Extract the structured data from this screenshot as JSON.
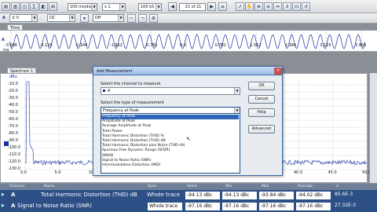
{
  "toolbar": {
    "channel": "A",
    "range": "± V",
    "coupling": "DC",
    "timebase": "100 ms/div",
    "multiplier": "x 1",
    "samples": "100 kS",
    "page": "21 of 21",
    "trigger": "Off"
  },
  "time_view": {
    "tab": "Time",
    "unit": "ms",
    "ticks": [
      "-3.906",
      "-3.125",
      "-2.344",
      "-1.562",
      "-0.781",
      "0.0",
      "0.781",
      "1.562",
      "2.344",
      "3.125",
      "3.906"
    ],
    "y_label": "A"
  },
  "spectrum": {
    "tab": "Spectrum 1",
    "unit": "dBu",
    "y_ticks": [
      "-10.0",
      "-20.0",
      "-30.0",
      "-40.0",
      "-50.0",
      "-60.0",
      "-70.0",
      "-80.0",
      "-90.0",
      "-100.0",
      "-110.0",
      "-120.0",
      "-130.0"
    ],
    "x_ticks": [
      "0.0",
      "5.0",
      "10.0",
      "15.0",
      "20.0",
      "25.0",
      "30.0",
      "35.0",
      "40.0",
      "45.0",
      "50.0"
    ]
  },
  "dialog": {
    "title": "Add Measurement",
    "channel_label": "Select the channel to measure",
    "channel_value": "A",
    "type_label": "Select the type of measurement",
    "type_value": "Frequency at Peak",
    "buttons": {
      "ok": "OK",
      "cancel": "Cancel",
      "help": "Help",
      "advanced": "Advanced"
    },
    "options": [
      "Frequency at Peak",
      "Amplitude at Peak",
      "Average Amplitude at Peak",
      "Total Power",
      "Total Harmonic Distortion (THD) %",
      "Total Harmonic Distortion (THD) dB",
      "Total Harmonic Distortion plus Noise (THD+N)",
      "Spurious Free Dynamic Range (SFDR)",
      "SINAD",
      "Signal to Noise Ratio (SNR)",
      "Intermodulation Distortion (IMD)"
    ],
    "selected_index": 0
  },
  "measurements": {
    "headers": [
      "Channel",
      "Name",
      "Span",
      "Value",
      "Min",
      "Max",
      "Average",
      "σ"
    ],
    "rows": [
      {
        "channel": "A",
        "name": "Total Harmonic Distortion (THD) dB",
        "span": "Whole trace",
        "value": "-94.13 dBc",
        "min": "-94.13 dBc",
        "max": "-93.84 dBc",
        "average": "-94.02 dBc",
        "sd": "85.6E-3"
      },
      {
        "channel": "A",
        "name": "Signal to Noise Ratio (SNR)",
        "span": "Whole trace",
        "value": "-97.16 dBc",
        "min": "-97.16 dBc",
        "max": "-97.16 dBc",
        "average": "-97.16 dBc",
        "sd": "27.32E-3"
      }
    ]
  },
  "colors": {
    "accent": "#2c4f86",
    "trace": "#1a2fa0",
    "selection": "#2f66b7"
  }
}
